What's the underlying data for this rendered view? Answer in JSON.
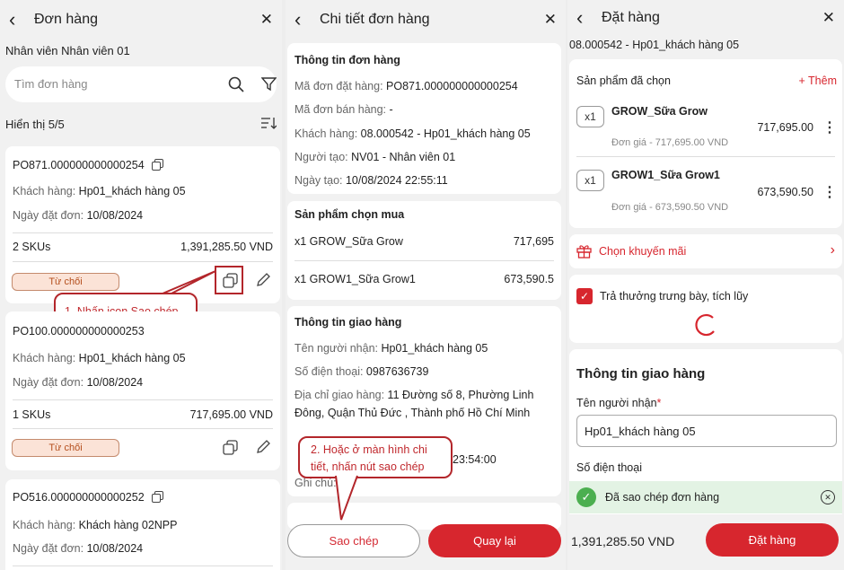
{
  "p1": {
    "title": "Đơn hàng",
    "employee": "Nhân viên Nhân viên 01",
    "search_placeholder": "Tìm đơn hàng",
    "showing": "Hiển thị 5/5",
    "orders": [
      {
        "code": "PO871.000000000000254",
        "customer": "Khách hàng: ",
        "customer_val": "Hp01_khách hàng 05",
        "date": "Ngày đặt đơn: ",
        "date_val": "10/08/2024",
        "skus": "2 SKUs",
        "total": "1,391,285.50 VND",
        "status": "Từ chối"
      },
      {
        "code": "PO100.000000000000253",
        "customer": "Khách hàng: ",
        "customer_val": "Hp01_khách hàng 05",
        "date": "Ngày đặt đơn: ",
        "date_val": "10/08/2024",
        "skus": "1 SKUs",
        "total": "717,695.00 VND",
        "status": "Từ chối"
      },
      {
        "code": "PO516.000000000000252",
        "customer": "Khách hàng: ",
        "customer_val": "Khách hàng 02NPP",
        "date": "Ngày đặt đơn: ",
        "date_val": "10/08/2024"
      }
    ],
    "callout": "1. Nhấn icon Sao chép"
  },
  "p2": {
    "title": "Chi tiết đơn hàng",
    "info_title": "Thông tin đơn hàng",
    "info": [
      {
        "label": "Mã đơn đặt hàng: ",
        "value": "PO871.000000000000254"
      },
      {
        "label": "Mã đơn bán hàng: ",
        "value": "-"
      },
      {
        "label": "Khách hàng: ",
        "value": "08.000542 - Hp01_khách hàng 05"
      },
      {
        "label": "Người tạo: ",
        "value": "NV01 - Nhân viên 01"
      },
      {
        "label": "Ngày tạo: ",
        "value": "10/08/2024 22:55:11"
      }
    ],
    "products_title": "Sản phẩm chọn mua",
    "products": [
      {
        "name": "x1 GROW_Sữa Grow",
        "price": "717,695"
      },
      {
        "name": "x1 GROW1_Sữa Grow1",
        "price": "673,590.5"
      }
    ],
    "delivery_title": "Thông tin giao hàng",
    "recipient_label": "Tên người nhận: ",
    "recipient": "Hp01_khách hàng 05",
    "phone_label": "Số điện thoại: ",
    "phone": "0987636739",
    "address_label": "Địa chỉ giao hàng: ",
    "address_1": "11 Đường số 8, Phường Linh",
    "address_2": "Đông, Quận Thủ Đức , Thành phố Hồ Chí Minh",
    "time_partial": "23:54:00",
    "note_label": "Ghi chú:",
    "callout_1": "2. Hoặc ở màn hình chi",
    "callout_2": "tiết, nhấn nút sao chép",
    "copy_btn": "Sao chép",
    "back_btn": "Quay lại"
  },
  "p3": {
    "title": "Đặt hàng",
    "subtitle": "08.000542 - Hp01_khách hàng 05",
    "selected_title": "Sản phẩm đã chọn",
    "add": "+ Thêm",
    "items": [
      {
        "qty": "x1",
        "name": "GROW_Sữa Grow",
        "total": "717,695.00",
        "unit": "Đơn giá - 717,695.00 VND"
      },
      {
        "qty": "x1",
        "name": "GROW1_Sữa Grow1",
        "total": "673,590.50",
        "unit": "Đơn giá - 673,590.50 VND"
      }
    ],
    "promo": "Chọn khuyến mãi",
    "reward": "Trả thưởng trưng bày, tích lũy",
    "delivery_title": "Thông tin giao hàng",
    "recipient_label": "Tên người nhận",
    "required_mark": "*",
    "recipient_value": "Hp01_khách hàng 05",
    "phone_label": "Số điện thoại",
    "toast": "Đã sao chép đơn hàng",
    "total": "1,391,285.50 VND",
    "order_btn": "Đặt hàng"
  },
  "colors": {
    "accent": "#d7262e",
    "toast_bg": "#e3f3e4",
    "toast_icon": "#4caf50"
  }
}
